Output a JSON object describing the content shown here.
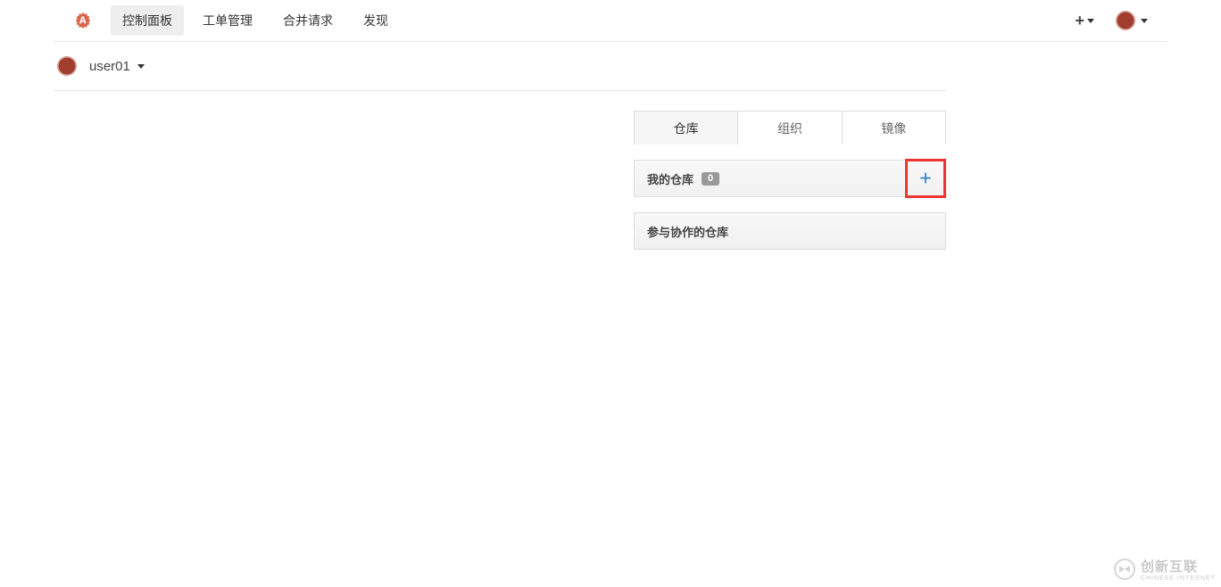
{
  "nav": {
    "items": [
      {
        "label": "控制面板",
        "active": true
      },
      {
        "label": "工单管理",
        "active": false
      },
      {
        "label": "合并请求",
        "active": false
      },
      {
        "label": "发现",
        "active": false
      }
    ]
  },
  "user": {
    "name": "user01"
  },
  "right": {
    "tabs": [
      {
        "label": "仓库",
        "active": true
      },
      {
        "label": "组织",
        "active": false
      },
      {
        "label": "镜像",
        "active": false
      }
    ],
    "my_repos": {
      "title": "我的仓库",
      "count": "0",
      "add_highlight": true
    },
    "collab": {
      "title": "参与协作的仓库"
    }
  },
  "watermark": {
    "main": "创新互联",
    "sub": "CHINESE INTERNET"
  }
}
